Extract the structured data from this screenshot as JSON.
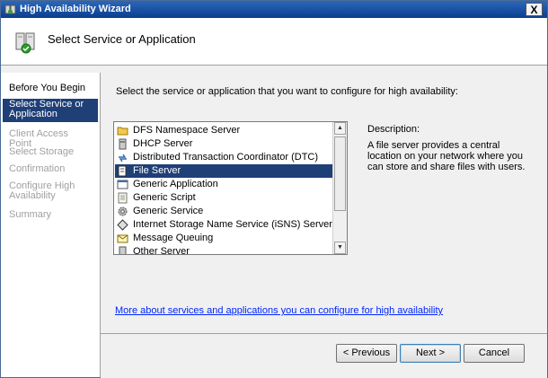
{
  "window": {
    "title": "High Availability Wizard",
    "close_label": "X"
  },
  "header": {
    "heading": "Select Service or Application"
  },
  "steps": [
    {
      "label": "Before You Begin",
      "state": "done"
    },
    {
      "label": "Select Service or Application",
      "state": "active"
    },
    {
      "label": "Client Access Point",
      "state": "disabled"
    },
    {
      "label": "Select Storage",
      "state": "disabled"
    },
    {
      "label": "Confirmation",
      "state": "disabled"
    },
    {
      "label": "Configure High Availability",
      "state": "disabled"
    },
    {
      "label": "Summary",
      "state": "disabled"
    }
  ],
  "main": {
    "instruction": "Select the service or application that you want to configure for high availability:",
    "services": [
      {
        "label": "DFS Namespace Server",
        "icon": "folder-icon"
      },
      {
        "label": "DHCP Server",
        "icon": "dhcp-server-icon"
      },
      {
        "label": "Distributed Transaction Coordinator (DTC)",
        "icon": "dtc-icon"
      },
      {
        "label": "File Server",
        "icon": "file-server-icon",
        "selected": true
      },
      {
        "label": "Generic Application",
        "icon": "application-icon"
      },
      {
        "label": "Generic Script",
        "icon": "script-icon"
      },
      {
        "label": "Generic Service",
        "icon": "gear-icon"
      },
      {
        "label": "Internet Storage Name Service (iSNS) Server",
        "icon": "isns-icon"
      },
      {
        "label": "Message Queuing",
        "icon": "message-queuing-icon"
      },
      {
        "label": "Other Server",
        "icon": "server-icon"
      }
    ],
    "description_label": "Description:",
    "description_text": "A file server provides a central location on your network where you can store and share files with users.",
    "more_link": "More about services and applications you can configure for high availability"
  },
  "footer": {
    "previous_label": "< Previous",
    "next_label": "Next >",
    "cancel_label": "Cancel"
  },
  "colors": {
    "selection": "#1f3f77",
    "titlebar": "#0b3f8f",
    "link": "#0026ff"
  }
}
